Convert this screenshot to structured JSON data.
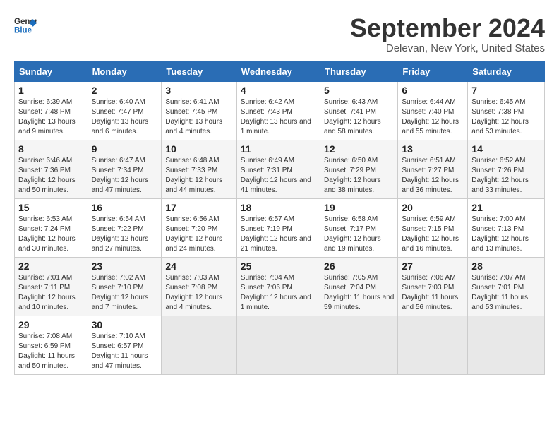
{
  "header": {
    "logo_line1": "General",
    "logo_line2": "Blue",
    "main_title": "September 2024",
    "subtitle": "Delevan, New York, United States"
  },
  "calendar": {
    "columns": [
      "Sunday",
      "Monday",
      "Tuesday",
      "Wednesday",
      "Thursday",
      "Friday",
      "Saturday"
    ],
    "weeks": [
      [
        {
          "day": "1",
          "sunrise": "6:39 AM",
          "sunset": "7:48 PM",
          "daylight": "13 hours and 9 minutes."
        },
        {
          "day": "2",
          "sunrise": "6:40 AM",
          "sunset": "7:47 PM",
          "daylight": "13 hours and 6 minutes."
        },
        {
          "day": "3",
          "sunrise": "6:41 AM",
          "sunset": "7:45 PM",
          "daylight": "13 hours and 4 minutes."
        },
        {
          "day": "4",
          "sunrise": "6:42 AM",
          "sunset": "7:43 PM",
          "daylight": "13 hours and 1 minute."
        },
        {
          "day": "5",
          "sunrise": "6:43 AM",
          "sunset": "7:41 PM",
          "daylight": "12 hours and 58 minutes."
        },
        {
          "day": "6",
          "sunrise": "6:44 AM",
          "sunset": "7:40 PM",
          "daylight": "12 hours and 55 minutes."
        },
        {
          "day": "7",
          "sunrise": "6:45 AM",
          "sunset": "7:38 PM",
          "daylight": "12 hours and 53 minutes."
        }
      ],
      [
        {
          "day": "8",
          "sunrise": "6:46 AM",
          "sunset": "7:36 PM",
          "daylight": "12 hours and 50 minutes."
        },
        {
          "day": "9",
          "sunrise": "6:47 AM",
          "sunset": "7:34 PM",
          "daylight": "12 hours and 47 minutes."
        },
        {
          "day": "10",
          "sunrise": "6:48 AM",
          "sunset": "7:33 PM",
          "daylight": "12 hours and 44 minutes."
        },
        {
          "day": "11",
          "sunrise": "6:49 AM",
          "sunset": "7:31 PM",
          "daylight": "12 hours and 41 minutes."
        },
        {
          "day": "12",
          "sunrise": "6:50 AM",
          "sunset": "7:29 PM",
          "daylight": "12 hours and 38 minutes."
        },
        {
          "day": "13",
          "sunrise": "6:51 AM",
          "sunset": "7:27 PM",
          "daylight": "12 hours and 36 minutes."
        },
        {
          "day": "14",
          "sunrise": "6:52 AM",
          "sunset": "7:26 PM",
          "daylight": "12 hours and 33 minutes."
        }
      ],
      [
        {
          "day": "15",
          "sunrise": "6:53 AM",
          "sunset": "7:24 PM",
          "daylight": "12 hours and 30 minutes."
        },
        {
          "day": "16",
          "sunrise": "6:54 AM",
          "sunset": "7:22 PM",
          "daylight": "12 hours and 27 minutes."
        },
        {
          "day": "17",
          "sunrise": "6:56 AM",
          "sunset": "7:20 PM",
          "daylight": "12 hours and 24 minutes."
        },
        {
          "day": "18",
          "sunrise": "6:57 AM",
          "sunset": "7:19 PM",
          "daylight": "12 hours and 21 minutes."
        },
        {
          "day": "19",
          "sunrise": "6:58 AM",
          "sunset": "7:17 PM",
          "daylight": "12 hours and 19 minutes."
        },
        {
          "day": "20",
          "sunrise": "6:59 AM",
          "sunset": "7:15 PM",
          "daylight": "12 hours and 16 minutes."
        },
        {
          "day": "21",
          "sunrise": "7:00 AM",
          "sunset": "7:13 PM",
          "daylight": "12 hours and 13 minutes."
        }
      ],
      [
        {
          "day": "22",
          "sunrise": "7:01 AM",
          "sunset": "7:11 PM",
          "daylight": "12 hours and 10 minutes."
        },
        {
          "day": "23",
          "sunrise": "7:02 AM",
          "sunset": "7:10 PM",
          "daylight": "12 hours and 7 minutes."
        },
        {
          "day": "24",
          "sunrise": "7:03 AM",
          "sunset": "7:08 PM",
          "daylight": "12 hours and 4 minutes."
        },
        {
          "day": "25",
          "sunrise": "7:04 AM",
          "sunset": "7:06 PM",
          "daylight": "12 hours and 1 minute."
        },
        {
          "day": "26",
          "sunrise": "7:05 AM",
          "sunset": "7:04 PM",
          "daylight": "11 hours and 59 minutes."
        },
        {
          "day": "27",
          "sunrise": "7:06 AM",
          "sunset": "7:03 PM",
          "daylight": "11 hours and 56 minutes."
        },
        {
          "day": "28",
          "sunrise": "7:07 AM",
          "sunset": "7:01 PM",
          "daylight": "11 hours and 53 minutes."
        }
      ],
      [
        {
          "day": "29",
          "sunrise": "7:08 AM",
          "sunset": "6:59 PM",
          "daylight": "11 hours and 50 minutes."
        },
        {
          "day": "30",
          "sunrise": "7:10 AM",
          "sunset": "6:57 PM",
          "daylight": "11 hours and 47 minutes."
        },
        null,
        null,
        null,
        null,
        null
      ]
    ]
  }
}
